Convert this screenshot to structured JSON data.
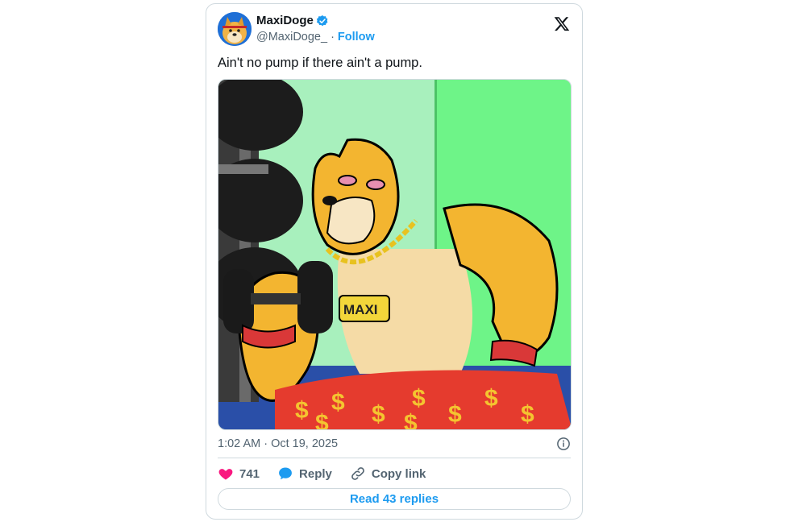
{
  "author": {
    "name": "MaxiDoge",
    "handle": "@MaxiDoge_",
    "separator": "·",
    "follow_label": "Follow",
    "verified": true
  },
  "tweet": {
    "text": "Ain't no pump if there ain't a pump.",
    "media_caption": "MAXI",
    "timestamp": "1:02 AM · Oct 19, 2025"
  },
  "actions": {
    "like_count": "741",
    "reply_label": "Reply",
    "copy_label": "Copy link"
  },
  "read_replies_label": "Read 43 replies",
  "icons": {
    "brand": "x-logo-icon",
    "verified": "verified-badge-icon",
    "info": "info-icon",
    "like": "heart-icon",
    "reply": "speech-bubble-icon",
    "copy": "link-icon"
  },
  "colors": {
    "accent": "#1d9bf0",
    "like": "#f91880",
    "muted": "#536471",
    "border": "#cfd9de"
  }
}
